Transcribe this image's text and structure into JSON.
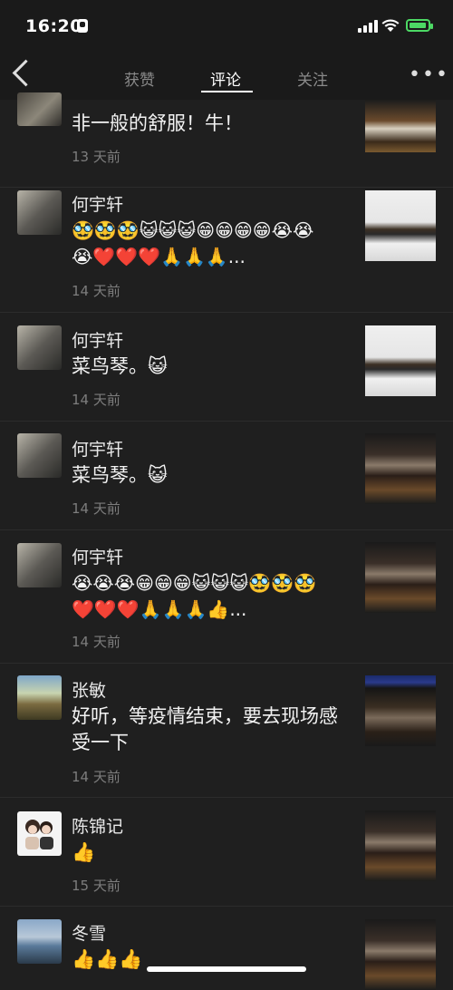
{
  "status": {
    "time": "16:20"
  },
  "tabs": [
    "获赞",
    "评论",
    "关注"
  ],
  "comments": [
    {
      "name": "",
      "text": "非一般的舒服！牛！",
      "time": "13 天前"
    },
    {
      "name": "何宇轩",
      "text": "🥸🥸🥸😺😺😺😁😁😁😁😭😭😭❤️❤️❤️🙏🙏🙏...",
      "time": "14 天前"
    },
    {
      "name": "何宇轩",
      "text": "菜鸟琴。😺",
      "time": "14 天前"
    },
    {
      "name": "何宇轩",
      "text": "菜鸟琴。😺",
      "time": "14 天前"
    },
    {
      "name": "何宇轩",
      "text": "😭😭😭😁😁😁😺😺😺🥸🥸🥸❤️❤️❤️🙏🙏🙏👍...",
      "time": "14 天前"
    },
    {
      "name": "张敏",
      "text": "好听，等疫情结束，要去现场感受一下",
      "time": "14 天前"
    },
    {
      "name": "陈锦记",
      "text": "👍",
      "time": "15 天前"
    },
    {
      "name": "冬雪",
      "text": "👍👍👍",
      "time": ""
    }
  ],
  "colors": {
    "background": "#1f1f1f",
    "battery": "#4cd964",
    "secondary_text": "#7d7d7d"
  }
}
